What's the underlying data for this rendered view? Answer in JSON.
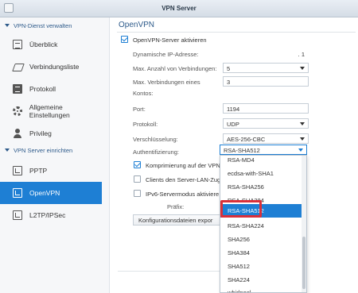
{
  "window": {
    "title": "VPN Server"
  },
  "sidebar": {
    "section1": "VPN-Dienst verwalten",
    "section2": "VPN Server einrichten",
    "items": [
      {
        "label": "Überblick",
        "icon": "overview-icon"
      },
      {
        "label": "Verbindungsliste",
        "icon": "connection-list-icon"
      },
      {
        "label": "Protokoll",
        "icon": "log-icon"
      },
      {
        "label": "Allgemeine Einstellungen",
        "icon": "gear-icon"
      },
      {
        "label": "Privileg",
        "icon": "user-icon"
      },
      {
        "label": "PPTP",
        "icon": "network-icon"
      },
      {
        "label": "OpenVPN",
        "icon": "network-icon",
        "active": true
      },
      {
        "label": "L2TP/IPSec",
        "icon": "network-icon"
      }
    ]
  },
  "main": {
    "title": "OpenVPN",
    "enable_label": "OpenVPN-Server aktivieren",
    "enable_checked": true,
    "dynamic_ip_label": "Dynamische IP-Adresse:",
    "dynamic_ip_value": ". 1",
    "max_conn_label": "Max. Anzahl von Verbindungen:",
    "max_conn_value": "5",
    "max_conn_account_label1": "Max. Verbindungen eines",
    "max_conn_account_label2": "Kontos:",
    "max_conn_account_value": "3",
    "port_label": "Port:",
    "port_value": "1194",
    "protocol_label": "Protokoll:",
    "protocol_value": "UDP",
    "encryption_label": "Verschlüsselung:",
    "encryption_value": "AES-256-CBC",
    "auth_label": "Authentifizierung:",
    "auth_value": "RSA-SHA512",
    "compress_label": "Komprimierung auf der VPN",
    "compress_checked": true,
    "lan_label": "Clients den Server-LAN-Zug",
    "lan_checked": false,
    "ipv6_label": "IPv6-Servermodus aktiviere",
    "ipv6_checked": false,
    "prefix_label": "Präfix:",
    "export_button": "Konfigurationsdateien expor"
  },
  "auth_dropdown": {
    "options": [
      "RSA-MD4",
      "ecdsa-with-SHA1",
      "RSA-SHA256",
      "RSA-SHA384",
      "RSA-SHA512",
      "RSA-SHA224",
      "SHA256",
      "SHA384",
      "SHA512",
      "SHA224",
      "whirlpool"
    ],
    "selected": "RSA-SHA512",
    "scroll_position": 0.59
  },
  "colors": {
    "accent": "#1e7fd4",
    "highlight": "#d9303a",
    "section": "#2d5a8a"
  }
}
